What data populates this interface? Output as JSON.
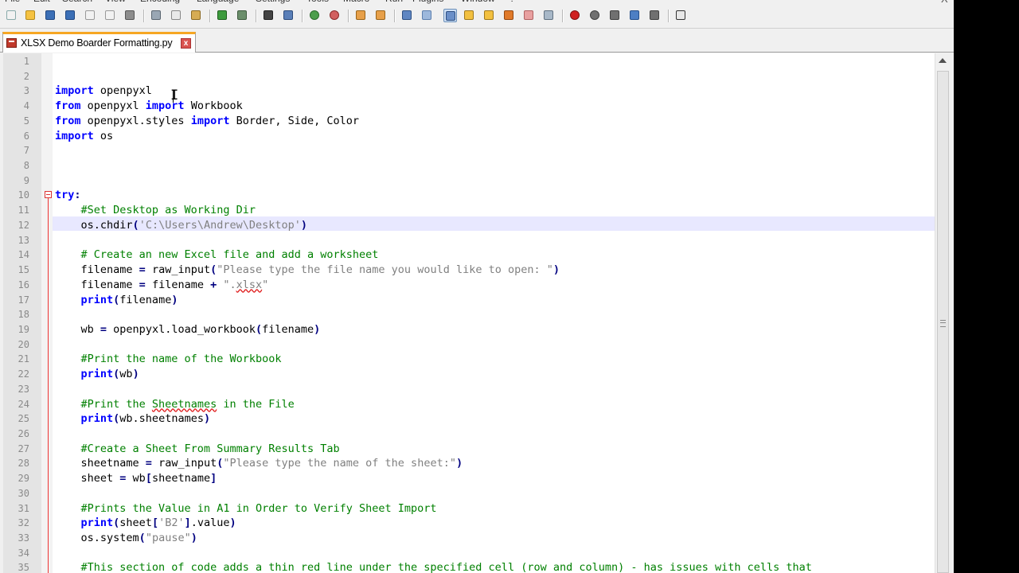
{
  "menubar": {
    "items": [
      "File",
      "Edit",
      "Search",
      "View",
      "Encoding",
      "Language",
      "Settings",
      "Tools",
      "Macro",
      "Run",
      "Plugins",
      "Window",
      "?"
    ],
    "close_glyph": "X"
  },
  "toolbar": {
    "buttons": [
      {
        "icon": "new-file-icon",
        "color": "#f2f2f2",
        "border": "#8aa"
      },
      {
        "icon": "open-file-icon",
        "color": "#f5c242",
        "border": "#b58a1a"
      },
      {
        "icon": "save-icon",
        "color": "#3b6fb6",
        "border": "#1f4680"
      },
      {
        "icon": "save-all-icon",
        "color": "#3b6fb6",
        "border": "#1f4680"
      },
      {
        "icon": "close-file-icon",
        "color": "#f2f2f2",
        "border": "#999"
      },
      {
        "icon": "close-all-icon",
        "color": "#f2f2f2",
        "border": "#999"
      },
      {
        "icon": "print-icon",
        "color": "#8d8d8d",
        "border": "#555"
      },
      {
        "icon": "cut-icon",
        "color": "#9aa7b4",
        "border": "#5a6570"
      },
      {
        "icon": "copy-icon",
        "color": "#e9e9e9",
        "border": "#888"
      },
      {
        "icon": "paste-icon",
        "color": "#d6ac54",
        "border": "#8c6a23"
      },
      {
        "icon": "undo-icon",
        "color": "#3d9b3d",
        "border": "#1e5e1e"
      },
      {
        "icon": "redo-icon",
        "color": "#6b8e6b",
        "border": "#3d5a3d"
      },
      {
        "icon": "find-icon",
        "color": "#444",
        "border": "#222"
      },
      {
        "icon": "replace-icon",
        "color": "#5a7fb8",
        "border": "#2c4a7a"
      },
      {
        "icon": "zoom-in-icon",
        "color": "#4c9e4c",
        "border": "#2a6a2a"
      },
      {
        "icon": "zoom-out-icon",
        "color": "#d26060",
        "border": "#8a2a2a"
      },
      {
        "icon": "sync-vertical-icon",
        "color": "#e7a04a",
        "border": "#9a6418"
      },
      {
        "icon": "sync-horizontal-icon",
        "color": "#e7a04a",
        "border": "#9a6418"
      },
      {
        "icon": "word-wrap-icon",
        "color": "#5f86c2",
        "border": "#2d4f82"
      },
      {
        "icon": "show-all-characters-icon",
        "color": "#9db8dc",
        "border": "#5d7fae"
      },
      {
        "icon": "indent-guide-icon",
        "color": "#6a8fc8",
        "border": "#2d4f82",
        "pressed": true
      },
      {
        "icon": "user-defined-language-icon",
        "color": "#f2c040",
        "border": "#a0781a"
      },
      {
        "icon": "document-map-icon",
        "color": "#f2c040",
        "border": "#a0781a"
      },
      {
        "icon": "function-list-icon",
        "color": "#e07a2a",
        "border": "#94470f"
      },
      {
        "icon": "folder-as-workspace-icon",
        "color": "#e8a0a0",
        "border": "#b06060"
      },
      {
        "icon": "monitoring-icon",
        "color": "#a8b8c8",
        "border": "#607080"
      },
      {
        "icon": "start-recording-icon",
        "color": "#d02020",
        "border": "#801010"
      },
      {
        "icon": "stop-recording-icon",
        "color": "#707070",
        "border": "#404040"
      },
      {
        "icon": "playback-icon",
        "color": "#707070",
        "border": "#404040"
      },
      {
        "icon": "run-macro-multiple-icon",
        "color": "#4d7fc4",
        "border": "#254f8a"
      },
      {
        "icon": "save-macro-icon",
        "color": "#707070",
        "border": "#404040"
      },
      {
        "icon": "spell-check-icon",
        "color": "#e8e8e8",
        "border": "#333"
      }
    ]
  },
  "tab": {
    "label": "XLSX Demo Boarder Formatting.py",
    "close_glyph": "x"
  },
  "editor": {
    "lines": [
      {
        "num": "1",
        "segments": []
      },
      {
        "num": "2",
        "segments": []
      },
      {
        "num": "3",
        "segments": [
          {
            "t": "import",
            "c": "kw"
          },
          {
            "t": " openpyxl",
            "c": ""
          }
        ]
      },
      {
        "num": "4",
        "segments": [
          {
            "t": "from",
            "c": "kw"
          },
          {
            "t": " openpyxl ",
            "c": ""
          },
          {
            "t": "import",
            "c": "kw"
          },
          {
            "t": " Workbook",
            "c": ""
          }
        ]
      },
      {
        "num": "5",
        "segments": [
          {
            "t": "from",
            "c": "kw"
          },
          {
            "t": " openpyxl.styles ",
            "c": ""
          },
          {
            "t": "import",
            "c": "kw"
          },
          {
            "t": " Border, Side, Color",
            "c": ""
          }
        ]
      },
      {
        "num": "6",
        "segments": [
          {
            "t": "import",
            "c": "kw"
          },
          {
            "t": " os",
            "c": ""
          }
        ]
      },
      {
        "num": "7",
        "segments": []
      },
      {
        "num": "8",
        "segments": []
      },
      {
        "num": "9",
        "segments": []
      },
      {
        "num": "10",
        "segments": [
          {
            "t": "try",
            "c": "kw"
          },
          {
            "t": ":",
            "c": "op"
          }
        ]
      },
      {
        "num": "11",
        "segments": [
          {
            "t": "    #Set Desktop as Working Dir",
            "c": "cm"
          }
        ]
      },
      {
        "num": "12",
        "segments": [
          {
            "t": "    os.chdir",
            "c": ""
          },
          {
            "t": "(",
            "c": "op"
          },
          {
            "t": "'C:\\Users\\Andrew\\Desktop'",
            "c": "st"
          },
          {
            "t": ")",
            "c": "op"
          }
        ]
      },
      {
        "num": "13",
        "segments": []
      },
      {
        "num": "14",
        "segments": [
          {
            "t": "    # Create an new Excel file and add a worksheet",
            "c": "cm"
          }
        ]
      },
      {
        "num": "15",
        "segments": [
          {
            "t": "    filename ",
            "c": ""
          },
          {
            "t": "=",
            "c": "op"
          },
          {
            "t": " raw_input",
            "c": ""
          },
          {
            "t": "(",
            "c": "op"
          },
          {
            "t": "\"Please type the file name you would like to open: \"",
            "c": "st"
          },
          {
            "t": ")",
            "c": "op"
          }
        ]
      },
      {
        "num": "16",
        "segments": [
          {
            "t": "    filename ",
            "c": ""
          },
          {
            "t": "=",
            "c": "op"
          },
          {
            "t": " filename ",
            "c": ""
          },
          {
            "t": "+",
            "c": "op"
          },
          {
            "t": " \".",
            "c": "st"
          },
          {
            "t": "xlsx",
            "c": "st sq"
          },
          {
            "t": "\"",
            "c": "st"
          }
        ]
      },
      {
        "num": "17",
        "segments": [
          {
            "t": "    ",
            "c": ""
          },
          {
            "t": "print",
            "c": "kw"
          },
          {
            "t": "(",
            "c": "op"
          },
          {
            "t": "filename",
            "c": ""
          },
          {
            "t": ")",
            "c": "op"
          }
        ]
      },
      {
        "num": "18",
        "segments": []
      },
      {
        "num": "19",
        "segments": [
          {
            "t": "    wb ",
            "c": ""
          },
          {
            "t": "=",
            "c": "op"
          },
          {
            "t": " openpyxl.load_workbook",
            "c": ""
          },
          {
            "t": "(",
            "c": "op"
          },
          {
            "t": "filename",
            "c": ""
          },
          {
            "t": ")",
            "c": "op"
          }
        ]
      },
      {
        "num": "20",
        "segments": []
      },
      {
        "num": "21",
        "segments": [
          {
            "t": "    #Print the name of the Workbook",
            "c": "cm"
          }
        ]
      },
      {
        "num": "22",
        "segments": [
          {
            "t": "    ",
            "c": ""
          },
          {
            "t": "print",
            "c": "kw"
          },
          {
            "t": "(",
            "c": "op"
          },
          {
            "t": "wb",
            "c": ""
          },
          {
            "t": ")",
            "c": "op"
          }
        ]
      },
      {
        "num": "23",
        "segments": []
      },
      {
        "num": "24",
        "segments": [
          {
            "t": "    #Print the ",
            "c": "cm"
          },
          {
            "t": "Sheetnames",
            "c": "cm sq"
          },
          {
            "t": " in the File",
            "c": "cm"
          }
        ]
      },
      {
        "num": "25",
        "segments": [
          {
            "t": "    ",
            "c": ""
          },
          {
            "t": "print",
            "c": "kw"
          },
          {
            "t": "(",
            "c": "op"
          },
          {
            "t": "wb.sheetnames",
            "c": ""
          },
          {
            "t": ")",
            "c": "op"
          }
        ]
      },
      {
        "num": "26",
        "segments": []
      },
      {
        "num": "27",
        "segments": [
          {
            "t": "    #Create a Sheet From Summary Results Tab",
            "c": "cm"
          }
        ]
      },
      {
        "num": "28",
        "segments": [
          {
            "t": "    sheetname ",
            "c": ""
          },
          {
            "t": "=",
            "c": "op"
          },
          {
            "t": " raw_input",
            "c": ""
          },
          {
            "t": "(",
            "c": "op"
          },
          {
            "t": "\"Please type the name of the sheet:\"",
            "c": "st"
          },
          {
            "t": ")",
            "c": "op"
          }
        ]
      },
      {
        "num": "29",
        "segments": [
          {
            "t": "    sheet ",
            "c": ""
          },
          {
            "t": "=",
            "c": "op"
          },
          {
            "t": " wb",
            "c": ""
          },
          {
            "t": "[",
            "c": "op"
          },
          {
            "t": "sheetname",
            "c": ""
          },
          {
            "t": "]",
            "c": "op"
          }
        ]
      },
      {
        "num": "30",
        "segments": []
      },
      {
        "num": "31",
        "segments": [
          {
            "t": "    #Prints the Value in A1 in Order to Verify Sheet Import",
            "c": "cm"
          }
        ]
      },
      {
        "num": "32",
        "segments": [
          {
            "t": "    ",
            "c": ""
          },
          {
            "t": "print",
            "c": "kw"
          },
          {
            "t": "(",
            "c": "op"
          },
          {
            "t": "sheet",
            "c": ""
          },
          {
            "t": "[",
            "c": "op"
          },
          {
            "t": "'B2'",
            "c": "st"
          },
          {
            "t": "]",
            "c": "op"
          },
          {
            "t": ".value",
            "c": ""
          },
          {
            "t": ")",
            "c": "op"
          }
        ]
      },
      {
        "num": "33",
        "segments": [
          {
            "t": "    os.system",
            "c": ""
          },
          {
            "t": "(",
            "c": "op"
          },
          {
            "t": "\"pause\"",
            "c": "st"
          },
          {
            "t": ")",
            "c": "op"
          }
        ]
      },
      {
        "num": "34",
        "segments": []
      },
      {
        "num": "35",
        "segments": [
          {
            "t": "    #This section of code adds a thin red line under the specified cell (row and column) - has issues with cells that",
            "c": "cm"
          }
        ]
      }
    ]
  }
}
